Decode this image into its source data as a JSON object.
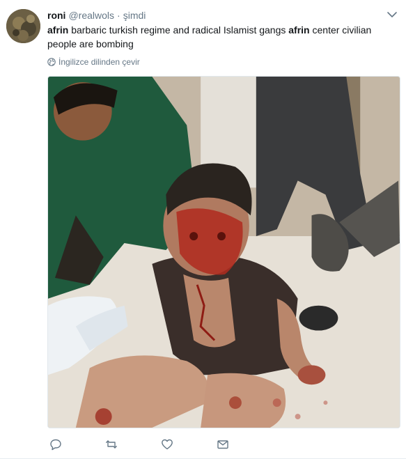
{
  "tweet": {
    "display_name": "roni",
    "handle": "@realwols",
    "separator": "·",
    "time": "şimdi",
    "text_parts": [
      {
        "t": "afrin",
        "bold": true
      },
      {
        "t": " barbaric turkish regime and radical Islamist gangs ",
        "bold": false
      },
      {
        "t": "afrin",
        "bold": true
      },
      {
        "t": " center civilian people are bombing",
        "bold": false
      }
    ],
    "translate_label": "İngilizce dilinden çevir"
  },
  "icons": {
    "more": "chevron-down-icon",
    "translate": "globe-icon",
    "reply": "reply-icon",
    "retweet": "retweet-icon",
    "like": "heart-icon",
    "message": "envelope-icon"
  },
  "colors": {
    "text": "#14171a",
    "secondary": "#657786",
    "border": "#e6ecf0"
  }
}
